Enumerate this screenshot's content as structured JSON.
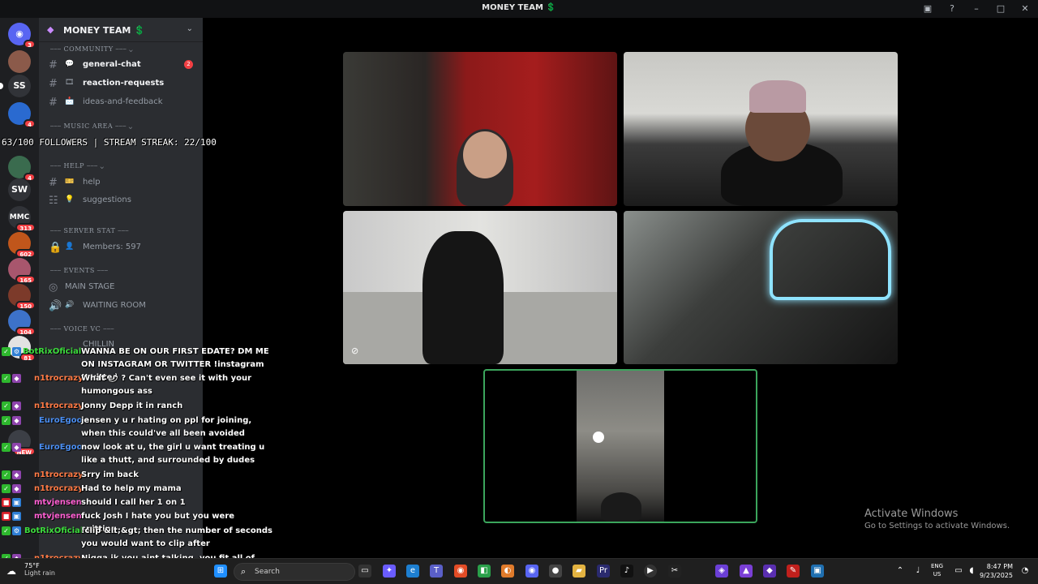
{
  "window": {
    "title": "MONEY TEAM 💲"
  },
  "overlay": {
    "followers": "63/100 FOLLOWERS | STREAM STREAK: 22/100"
  },
  "rail": {
    "items": [
      {
        "label": "",
        "badge": "3"
      },
      {
        "label": "",
        "badge": ""
      },
      {
        "label": "SS",
        "badge": ""
      },
      {
        "label": "",
        "badge": "4"
      },
      {
        "label": "",
        "badge": "4"
      },
      {
        "label": "SW",
        "badge": ""
      },
      {
        "label": "MMC",
        "badge": "313"
      },
      {
        "label": "",
        "badge": "602"
      },
      {
        "label": "",
        "badge": "165"
      },
      {
        "label": "",
        "badge": "150"
      },
      {
        "label": "",
        "badge": "104"
      },
      {
        "label": "",
        "badge": "81"
      },
      {
        "label": "",
        "badge": "NEW"
      }
    ]
  },
  "sidebar": {
    "server_name": "MONEY TEAM 💲",
    "categories": {
      "community": "COMMUNITY",
      "music": "MUSIC AREA",
      "help": "HELP",
      "server_stat": "SERVER STAT",
      "events": "EVENTS",
      "voice": "VOICE VC"
    },
    "channels": {
      "general_chat": "general-chat",
      "general_chat_count": "2",
      "reaction_requests": "reaction-requests",
      "ideas_feedback": "ideas-and-feedback",
      "help": "help",
      "suggestions": "suggestions",
      "members": "Members: 597",
      "main_stage": "MAIN STAGE",
      "waiting_room": "WAITING ROOM",
      "chillin": "CHILLIN"
    }
  },
  "chat": [
    {
      "user": "BotRixOficial",
      "color": "#3ddc3d",
      "text": "WANNA BE ON OUR FIRST EDATE? DM ME ON INSTAGRAM OR TWITTER !instagram !twitter"
    },
    {
      "user": "n1trocrazy",
      "color": "#ff7a45",
      "text": "What 🌶 ? Can't even see it with your humongous ass"
    },
    {
      "user": "n1trocrazy",
      "color": "#ff7a45",
      "text": "Jonny Depp it in ranch"
    },
    {
      "user": "EuroEgoo",
      "color": "#4a8df0",
      "text": "jensen y u r hating on ppl for joining, when this could've all been avoided"
    },
    {
      "user": "EuroEgoo",
      "color": "#4a8df0",
      "text": "now look at u, the girl u want treating u like a thutt, and surrounded by dudes"
    },
    {
      "user": "n1trocrazy",
      "color": "#ff7a45",
      "text": "Srry im back"
    },
    {
      "user": "n1trocrazy",
      "color": "#ff7a45",
      "text": "Had to help my mama"
    },
    {
      "user": "mtvjensen",
      "color": "#ff5fd2",
      "text": "should I call her 1 on 1"
    },
    {
      "user": "mtvjensen",
      "color": "#ff5fd2",
      "text": "fuck Josh I hate you but you were spitting"
    },
    {
      "user": "BotRixOficial",
      "color": "#3ddc3d",
      "text": "!clip &lt;&gt; then the number of seconds you would want to clip after"
    },
    {
      "user": "n1trocrazy",
      "color": "#ff7a45",
      "text": "Nigga jk you aint talking, you fit all of your fucking house"
    }
  ],
  "activate": {
    "title": "Activate Windows",
    "subtitle": "Go to Settings to activate Windows."
  },
  "taskbar": {
    "weather_temp": "75°F",
    "weather_cond": "Light rain",
    "search_placeholder": "Search",
    "lang": "ENG",
    "region": "US",
    "time": "8:47 PM",
    "date": "9/23/2025"
  }
}
